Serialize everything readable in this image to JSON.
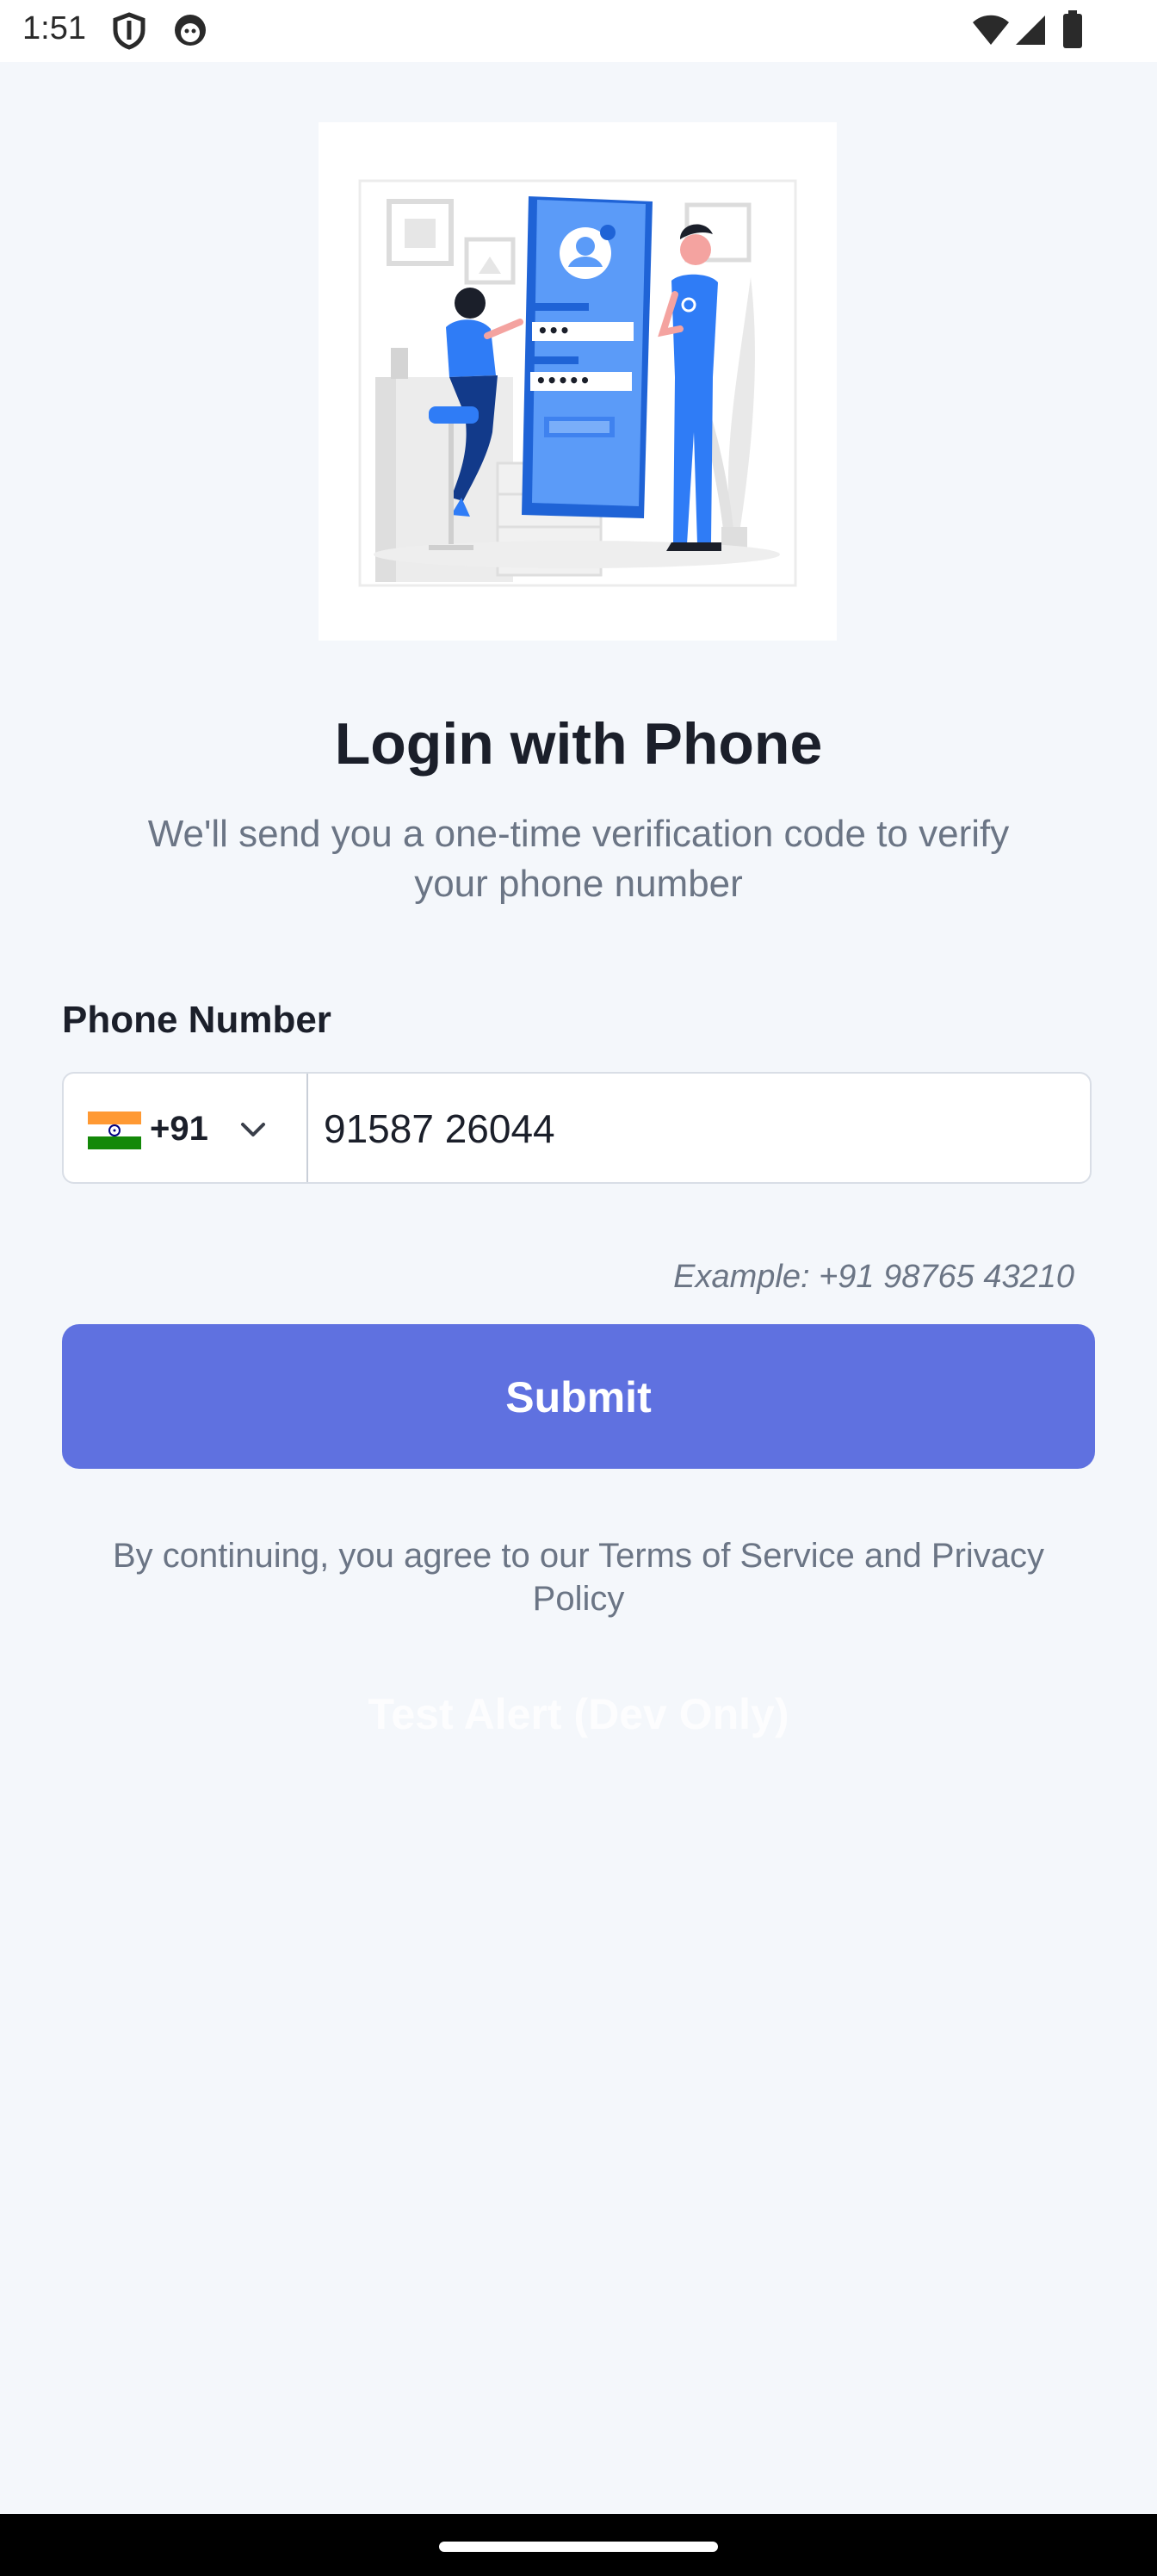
{
  "status_bar": {
    "time": "1:51",
    "icons": [
      "shield-icon",
      "smiley-app-icon",
      "wifi-icon",
      "signal-icon",
      "battery-icon"
    ]
  },
  "illustration": {
    "icon": "login-illustration-icon",
    "pin_mask_1": "•••",
    "pin_mask_2": "•••••"
  },
  "header": {
    "title": "Login with Phone",
    "subtitle": "We'll send you a one-time verification code to verify your phone number"
  },
  "form": {
    "phone_label": "Phone Number",
    "country": {
      "flag_icon": "india-flag-icon",
      "dial_code": "+91",
      "chevron_icon": "chevron-down-icon"
    },
    "phone_value": "91587 26044",
    "example_text": "Example: +91 98765 43210",
    "submit_label": "Submit"
  },
  "footer": {
    "terms_text": "By continuing, you agree to our Terms of Service and Privacy Policy",
    "test_alert_label": "Test Alert (Dev Only)"
  },
  "colors": {
    "background": "#f4f7fb",
    "primary": "#5f71e0",
    "illustration_blue": "#2f7cf6",
    "text_dark": "#1b1f2a",
    "text_muted": "#6b7585"
  }
}
